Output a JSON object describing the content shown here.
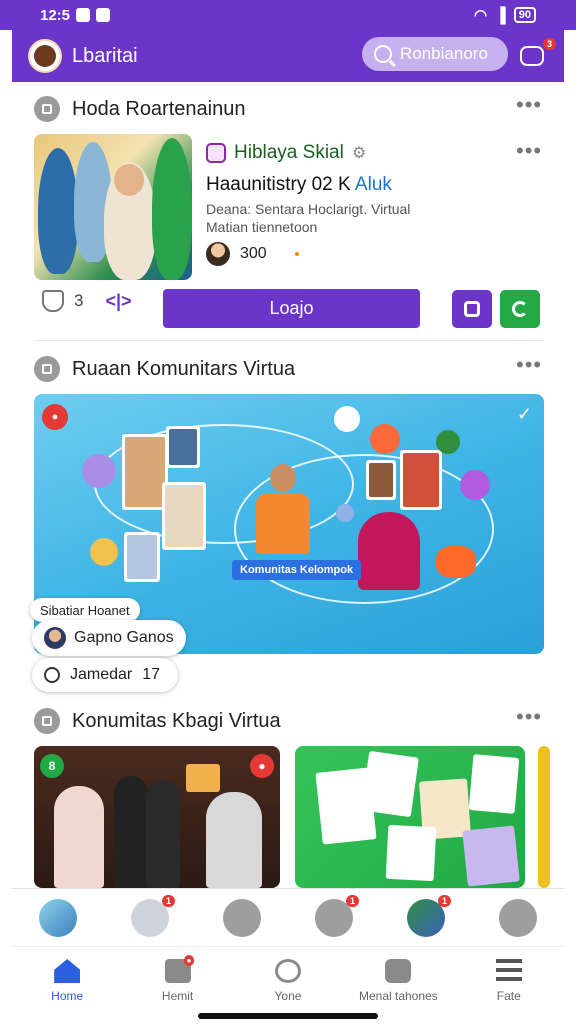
{
  "status_bar": {
    "time": "12:5",
    "battery": "90"
  },
  "app_bar": {
    "title": "Lbaritai",
    "search_placeholder": "Ronbianoro",
    "chat_badge": "3"
  },
  "section1": {
    "heading": "Hoda Roartenainun",
    "card": {
      "title": "Hiblaya Skial",
      "subtitle_main": "Haaunitistry 02 K",
      "subtitle_accent": "Aluk",
      "description": "Deana: Sentara Hoclarigt. Virtual Matian tiennetoon",
      "member_count": "300",
      "like_count": "3",
      "join_label": "Loajo"
    }
  },
  "section2": {
    "heading": "Ruaan Komunitars Virtua",
    "banner_label": "Komunitas Kelompok",
    "tooltip": "Sibatiar Hoanet",
    "user_pill": "Gapno Ganos",
    "search_pill": "Jamedar",
    "search_count": "17"
  },
  "section3": {
    "heading": "Konumitas Kbagi Virtua"
  },
  "icon_row": {
    "badges": [
      "1",
      "1",
      "1"
    ]
  },
  "tabs": [
    {
      "label": "Home",
      "icon": "home-icon",
      "active": true
    },
    {
      "label": "Hemit",
      "icon": "people-icon",
      "active": false
    },
    {
      "label": "Yone",
      "icon": "compass-icon",
      "active": false
    },
    {
      "label": "Menal tahones",
      "icon": "group-icon",
      "active": false
    },
    {
      "label": "Fate",
      "icon": "menu-icon",
      "active": false
    }
  ],
  "colors": {
    "brand": "#6c35c9",
    "accent_green": "#22a844",
    "active_tab": "#2b5fe0",
    "badge": "#e53935"
  }
}
